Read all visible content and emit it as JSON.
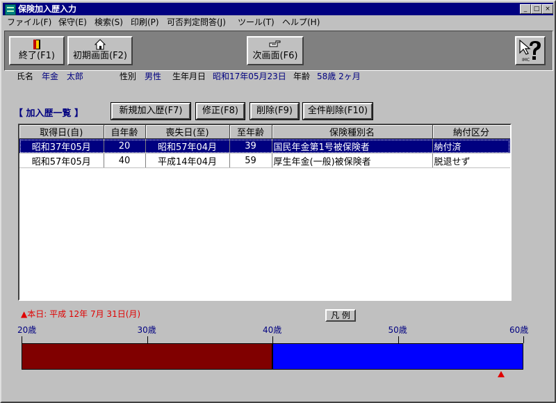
{
  "window": {
    "title": "保険加入歴入力"
  },
  "menu": [
    "ファイル(F)",
    "保守(E)",
    "検索(S)",
    "印刷(P)",
    "可否判定問答(J)",
    "ツール(T)",
    "ヘルプ(H)"
  ],
  "toolbar": {
    "exit_label": "終了(F1)",
    "home_label": "初期画面(F2)",
    "next_label": "次画面(F6)",
    "help_icon_text": "IMC"
  },
  "patient": {
    "name_label": "氏名",
    "name_value": "年金　太郎",
    "sex_label": "性別",
    "sex_value": "男性",
    "birth_label": "生年月日",
    "birth_value": "昭和17年05月23日",
    "age_label": "年齢",
    "age_value": "58歳 2ヶ月"
  },
  "history": {
    "title": "【 加入歴一覧 】",
    "buttons": {
      "new": "新規加入歴(F7)",
      "edit": "修正(F8)",
      "delete": "削除(F9)",
      "delete_all": "全件削除(F10)"
    },
    "columns": [
      "取得日(自)",
      "自年齢",
      "喪失日(至)",
      "至年齢",
      "保険種別名",
      "納付区分"
    ],
    "rows": [
      [
        "昭和37年05月",
        "20",
        "昭和57年04月",
        "39",
        "国民年金第1号被保険者",
        "納付済"
      ],
      [
        "昭和57年05月",
        "40",
        "平成14年04月",
        "59",
        "厚生年金(一般)被保険者",
        "脱退せず"
      ]
    ]
  },
  "timeline": {
    "today_label": "▲本日: 平成 12年 7月 31日(月)",
    "legend_label": "凡 例",
    "ticks": [
      {
        "age": 20,
        "label": "20歳"
      },
      {
        "age": 30,
        "label": "30歳"
      },
      {
        "age": 40,
        "label": "40歳"
      },
      {
        "age": 50,
        "label": "50歳"
      },
      {
        "age": 60,
        "label": "60歳"
      }
    ],
    "range": [
      20,
      60
    ],
    "segments": [
      {
        "from": 20,
        "to": 40,
        "color": "#800000"
      },
      {
        "from": 40,
        "to": 60,
        "color": "#0000ff"
      }
    ],
    "current_age": 58.2
  }
}
